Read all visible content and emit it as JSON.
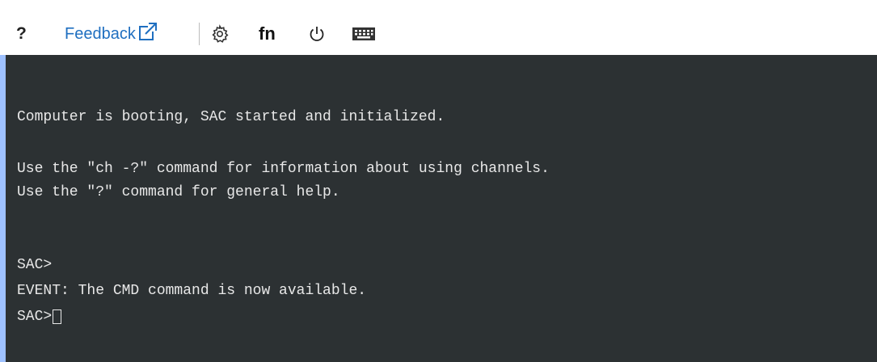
{
  "toolbar": {
    "help_label": "?",
    "feedback_label": "Feedback",
    "fn_label": "fn",
    "icons": {
      "feedback": "external-link-icon",
      "settings": "gear-icon",
      "power": "power-icon",
      "keyboard": "keyboard-icon"
    },
    "link_color": "#1f6fc0"
  },
  "terminal": {
    "background": "#2c3133",
    "foreground": "#e8e8e8",
    "lines": [
      "Computer is booting, SAC started and initialized.",
      "Use the \"ch -?\" command for information about using channels.",
      "Use the \"?\" command for general help.",
      "SAC>",
      "EVENT: The CMD command is now available.",
      "SAC>"
    ]
  }
}
